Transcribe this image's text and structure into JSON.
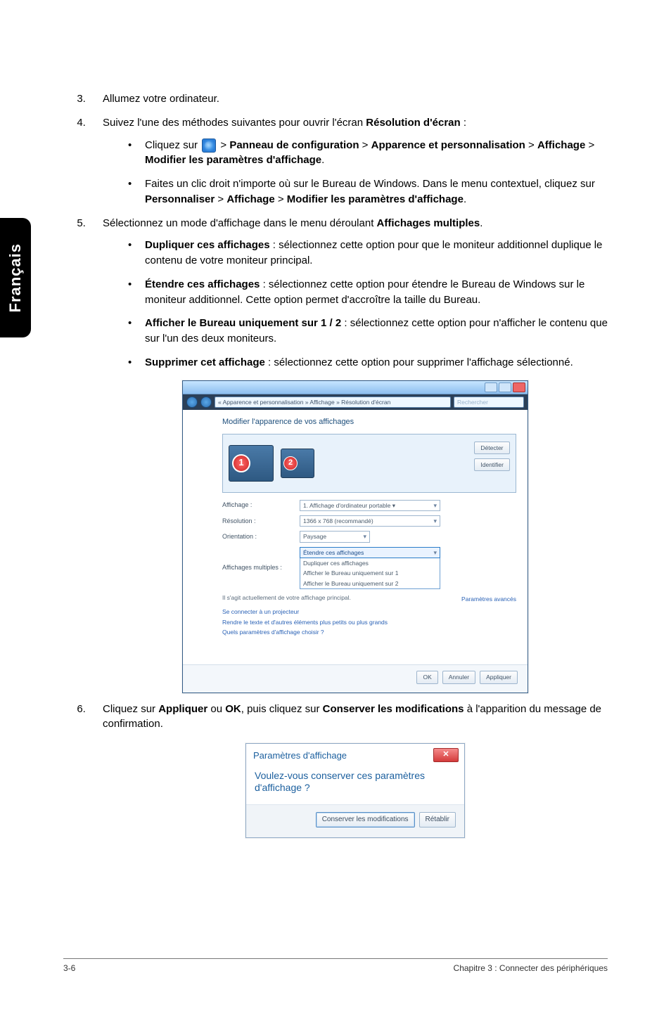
{
  "side_tab": "Français",
  "steps": {
    "s3": "Allumez votre ordinateur.",
    "s4_intro_a": "Suivez l'une des méthodes suivantes pour ouvrir l'écran ",
    "s4_intro_b": "Résolution d'écran",
    "s4_intro_c": " :",
    "s4_b1_a": "Cliquez sur ",
    "s4_b1_b": " > ",
    "s4_b1_c": "Panneau de configuration",
    "s4_b1_d": "Apparence et personnalisation",
    "s4_b1_e": "Affichage",
    "s4_b1_f": "Modifier les paramètres d'affichage",
    "s4_b2_a": "Faites un clic droit n'importe où sur le Bureau de Windows. Dans le menu contextuel, cliquez sur ",
    "s4_b2_b": "Personnaliser",
    "s4_b2_c": "Affichage",
    "s4_b2_d": "Modifier les paramètres d'affichage",
    "s5_intro_a": "Sélectionnez un mode d'affichage dans le menu déroulant ",
    "s5_intro_b": "Affichages multiples",
    "s5_b1_t": "Dupliquer ces affichages",
    "s5_b1_d": " : sélectionnez cette option pour que le moniteur additionnel duplique le contenu de votre moniteur principal.",
    "s5_b2_t": "Étendre ces affichages",
    "s5_b2_d": " : sélectionnez cette option pour étendre le Bureau de Windows sur le moniteur additionnel. Cette option permet d'accroître la taille du Bureau.",
    "s5_b3_t": "Afficher le Bureau uniquement sur 1 / 2",
    "s5_b3_d": " : sélectionnez cette option pour n'afficher le contenu que sur l'un des deux moniteurs.",
    "s5_b4_t": "Supprimer cet affichage",
    "s5_b4_d": " : sélectionnez cette option pour supprimer l'affichage sélectionné.",
    "s6_a": "Cliquez sur ",
    "s6_b": "Appliquer",
    "s6_c": " ou ",
    "s6_d": "OK",
    "s6_e": ", puis cliquez sur ",
    "s6_f": "Conserver les modifications",
    "s6_g": " à l'apparition du message de confirmation."
  },
  "screenshot1": {
    "breadcrumb": "« Apparence et personnalisation » Affichage » Résolution d'écran",
    "search_placeholder": "Rechercher",
    "heading": "Modifier l'apparence de vos affichages",
    "monitor1": "1",
    "monitor2": "2",
    "btn_detect": "Détecter",
    "btn_identify": "Identifier",
    "fields": {
      "display_label": "Affichage :",
      "display_value": "1. Affichage d'ordinateur portable ▾",
      "resolution_label": "Résolution :",
      "resolution_value": "1366 x 768 (recommandé)",
      "orientation_label": "Orientation :",
      "orientation_value": "Paysage",
      "multi_label": "Affichages multiples :",
      "multi_value": "Étendre ces affichages",
      "multi_opt1": "Dupliquer ces affichages",
      "multi_opt2": "Afficher le Bureau uniquement sur 1",
      "multi_opt3": "Afficher le Bureau uniquement sur 2"
    },
    "note_current": "Il s'agit actuellement de votre affichage principal.",
    "advanced_link": "Paramètres avancés",
    "link1": "Se connecter à un projecteur",
    "link2": "Rendre le texte et d'autres éléments plus petits ou plus grands",
    "link3": "Quels paramètres d'affichage choisir ?",
    "btn_ok": "OK",
    "btn_cancel": "Annuler",
    "btn_apply": "Appliquer"
  },
  "screenshot2": {
    "title": "Paramètres d'affichage",
    "message": "Voulez-vous conserver ces paramètres d'affichage ?",
    "btn_keep": "Conserver les modifications",
    "btn_revert": "Rétablir"
  },
  "footer": {
    "left": "3-6",
    "right": "Chapitre 3 : Connecter des périphériques"
  }
}
